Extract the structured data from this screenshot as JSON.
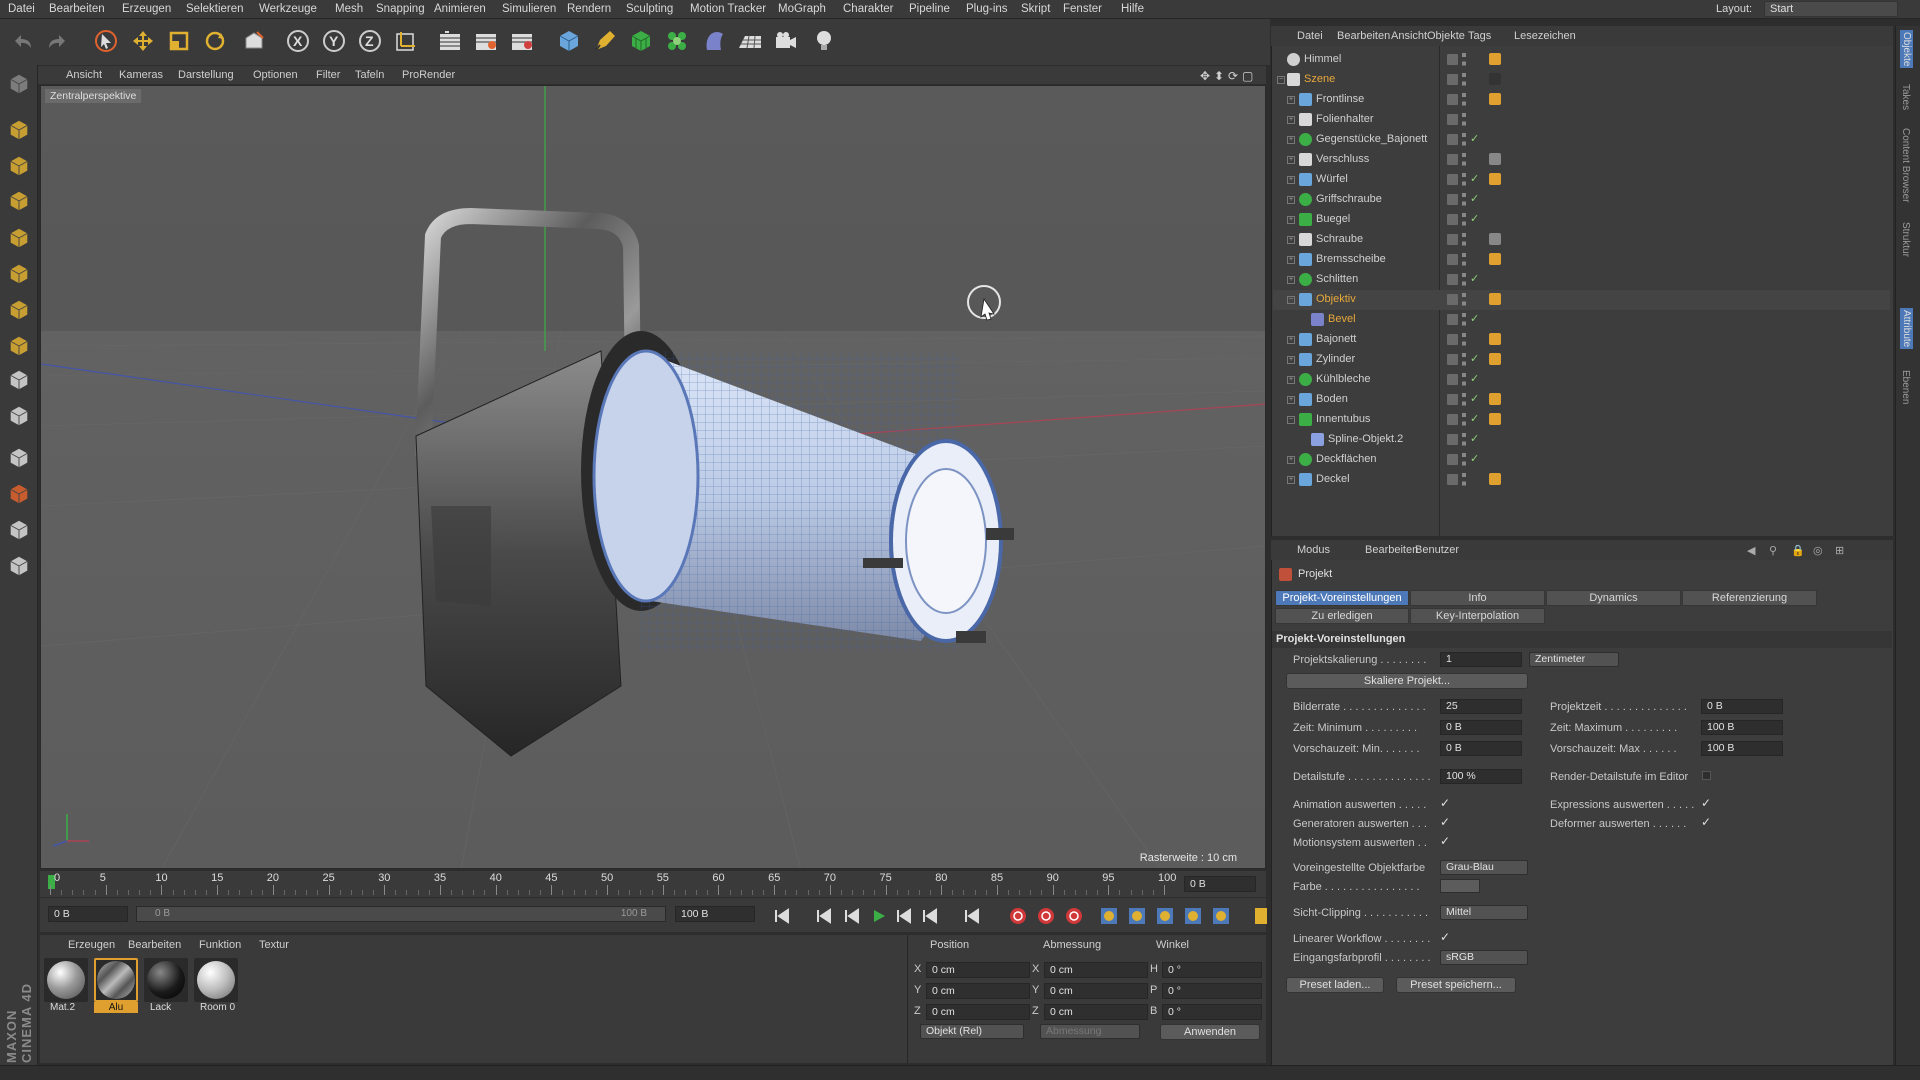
{
  "menubar": {
    "items": [
      "Datei",
      "Bearbeiten",
      "Erzeugen",
      "Selektieren",
      "Werkzeuge",
      "Mesh",
      "Snapping",
      "Animieren",
      "Simulieren",
      "Rendern",
      "Sculpting",
      "Motion Tracker",
      "MoGraph",
      "Charakter",
      "Pipeline",
      "Plug-ins",
      "Skript",
      "Fenster",
      "Hilfe"
    ],
    "layout_label": "Layout:",
    "layout_value": "Start"
  },
  "toolbar": {
    "icons": [
      "undo-icon",
      "redo-icon",
      "select-arrow-icon",
      "move-icon",
      "scale-icon",
      "rotate-icon",
      "last-tool-icon",
      "x-axis-lock-icon",
      "y-axis-lock-icon",
      "z-axis-lock-icon",
      "coordinate-system-icon",
      "render-view-icon",
      "render-picture-viewer-icon",
      "render-settings-icon",
      "cube-icon",
      "pen-icon",
      "subdivision-icon",
      "cloner-icon",
      "deformer-icon",
      "floor-icon",
      "camera-icon",
      "light-icon"
    ],
    "axis_labels": [
      "X",
      "Y",
      "Z"
    ]
  },
  "viewport": {
    "menu": [
      "Ansicht",
      "Kameras",
      "Darstellung",
      "Optionen",
      "Filter",
      "Tafeln",
      "ProRender"
    ],
    "label": "Zentralperspektive",
    "raster": "Rasterweite : 10 cm"
  },
  "timeline": {
    "ticks": [
      "0",
      "5",
      "10",
      "15",
      "20",
      "25",
      "30",
      "35",
      "40",
      "45",
      "50",
      "55",
      "60",
      "65",
      "70",
      "75",
      "80",
      "85",
      "90",
      "95",
      "100"
    ],
    "current_frame_field": "0 B",
    "start_field": "0 B",
    "range_start": "0 B",
    "range_end": "100 B",
    "end_field": "100 B"
  },
  "material_manager": {
    "tabs": [
      "Erzeugen",
      "Bearbeiten",
      "Funktion",
      "Textur"
    ],
    "materials": [
      {
        "label": "Mat.2"
      },
      {
        "label": "Alu"
      },
      {
        "label": "Lack"
      },
      {
        "label": "Room 0"
      }
    ]
  },
  "coordinate_manager": {
    "headers": [
      "Position",
      "Abmessung",
      "Winkel"
    ],
    "rows": [
      {
        "axis": "X",
        "pos": "0 cm",
        "dim_axis": "X",
        "dim": "0 cm",
        "rot_axis": "H",
        "rot": "0 °"
      },
      {
        "axis": "Y",
        "pos": "0 cm",
        "dim_axis": "Y",
        "dim": "0 cm",
        "rot_axis": "P",
        "rot": "0 °"
      },
      {
        "axis": "Z",
        "pos": "0 cm",
        "dim_axis": "Z",
        "dim": "0 cm",
        "rot_axis": "B",
        "rot": "0 °"
      }
    ],
    "mode_select": "Objekt (Rel)",
    "size_select": "Abmessung",
    "apply_button": "Anwenden"
  },
  "object_manager": {
    "menu": [
      "Datei",
      "Bearbeiten",
      "Ansicht",
      "Objekte",
      "Tags",
      "Lesezeichen"
    ],
    "objects": [
      {
        "name": "Himmel",
        "depth": 0,
        "icon": "sky-icon",
        "color": "#d0d0d0",
        "checked": false
      },
      {
        "name": "Szene",
        "depth": 0,
        "icon": "null-icon",
        "color": "#e7a83a",
        "checked": false
      },
      {
        "name": "Frontlinse",
        "depth": 1,
        "icon": "lathe-icon",
        "color": "#d0d0d0",
        "checked": false
      },
      {
        "name": "Folienhalter",
        "depth": 1,
        "icon": "null-icon",
        "color": "#d0d0d0",
        "checked": false
      },
      {
        "name": "Gegenstücke_Bajonett",
        "depth": 1,
        "icon": "symmetry-icon",
        "color": "#d0d0d0",
        "checked": true
      },
      {
        "name": "Verschluss",
        "depth": 1,
        "icon": "null-icon",
        "color": "#d0d0d0",
        "checked": false
      },
      {
        "name": "Würfel",
        "depth": 1,
        "icon": "cube-icon",
        "color": "#d0d0d0",
        "checked": true
      },
      {
        "name": "Griffschraube",
        "depth": 1,
        "icon": "symmetry-icon",
        "color": "#d0d0d0",
        "checked": true
      },
      {
        "name": "Buegel",
        "depth": 1,
        "icon": "sweep-icon",
        "color": "#d0d0d0",
        "checked": true
      },
      {
        "name": "Schraube",
        "depth": 1,
        "icon": "null-icon",
        "color": "#d0d0d0",
        "checked": false
      },
      {
        "name": "Bremsscheibe",
        "depth": 1,
        "icon": "lathe-icon",
        "color": "#d0d0d0",
        "checked": false
      },
      {
        "name": "Schlitten",
        "depth": 1,
        "icon": "symmetry-icon",
        "color": "#d0d0d0",
        "checked": true
      },
      {
        "name": "Objektiv",
        "depth": 1,
        "icon": "lathe-icon",
        "color": "#e7a83a",
        "checked": false
      },
      {
        "name": "Bevel",
        "depth": 2,
        "icon": "bevel-icon",
        "color": "#e7a83a",
        "checked": true
      },
      {
        "name": "Bajonett",
        "depth": 1,
        "icon": "lathe-icon",
        "color": "#d0d0d0",
        "checked": false
      },
      {
        "name": "Zylinder",
        "depth": 1,
        "icon": "cylinder-icon",
        "color": "#d0d0d0",
        "checked": true
      },
      {
        "name": "Kühlbleche",
        "depth": 1,
        "icon": "symmetry-icon",
        "color": "#d0d0d0",
        "checked": true
      },
      {
        "name": "Boden",
        "depth": 1,
        "icon": "cube-icon",
        "color": "#d0d0d0",
        "checked": true
      },
      {
        "name": "Innentubus",
        "depth": 1,
        "icon": "sweep-icon",
        "color": "#d0d0d0",
        "checked": true
      },
      {
        "name": "Spline-Objekt.2",
        "depth": 2,
        "icon": "spline-icon",
        "color": "#d0d0d0",
        "checked": true
      },
      {
        "name": "Deckflächen",
        "depth": 1,
        "icon": "symmetry-icon",
        "color": "#d0d0d0",
        "checked": true
      },
      {
        "name": "Deckel",
        "depth": 1,
        "icon": "lathe-icon",
        "color": "#d0d0d0",
        "checked": false
      }
    ]
  },
  "attribute_manager": {
    "menu": [
      "Modus",
      "Bearbeiten",
      "Benutzer"
    ],
    "object_title": "Projekt",
    "tabs_row1": [
      "Projekt-Voreinstellungen",
      "Info",
      "Dynamics",
      "Referenzierung"
    ],
    "tabs_row2": [
      "Zu erledigen",
      "Key-Interpolation"
    ],
    "section_title": "Projekt-Voreinstellungen",
    "projektskalierung_label": "Projektskalierung . . . . . . . .",
    "projektskalierung_value": "1",
    "projektskalierung_unit": "Zentimeter",
    "skalieren_button": "Skaliere Projekt...",
    "bilderrate_label": "Bilderrate . . . . . . . . . . . . . .",
    "bilderrate_value": "25",
    "projektzeit_label": "Projektzeit . . . . . . . . . . . . . .",
    "projektzeit_value": "0 B",
    "zeit_min_label": "Zeit: Minimum . . . . . . . . .",
    "zeit_min_value": "0 B",
    "zeit_max_label": "Zeit: Maximum . . . . . . . . .",
    "zeit_max_value": "100 B",
    "vor_min_label": "Vorschauzeit: Min. . . . . . .",
    "vor_min_value": "0 B",
    "vor_max_label": "Vorschauzeit: Max . . . . . .",
    "vor_max_value": "100 B",
    "detail_label": "Detailstufe . . . . . . . . . . . . . .",
    "detail_value": "100 %",
    "render_detail_label": "Render-Detailstufe im Editor",
    "anim_label": "Animation auswerten . . . . .",
    "expr_label": "Expressions auswerten . . . . .",
    "gen_label": "Generatoren auswerten . . .",
    "def_label": "Deformer auswerten . . . . . .",
    "motion_label": "Motionsystem auswerten . .",
    "objfarbe_label": "Voreingestellte Objektfarbe",
    "objfarbe_value": "Grau-Blau",
    "farbe_label": "Farbe . . . . . . . . . . . . . . . .",
    "clip_label": "Sicht-Clipping . . . . . . . . . . .",
    "clip_value": "Mittel",
    "linear_label": "Linearer Workflow . . . . . . . .",
    "profil_label": "Eingangsfarbprofil . . . . . . . .",
    "profil_value": "sRGB",
    "preset_load": "Preset laden...",
    "preset_save": "Preset speichern..."
  },
  "right_strip": {
    "tabs": [
      "Objekte",
      "Takes",
      "Content Browser",
      "Struktur",
      "Attribute",
      "Ebenen"
    ]
  },
  "branding": {
    "text": "MAXON CINEMA 4D"
  },
  "colors": {
    "accent": "#4d79b8",
    "active_orange": "#e7a83a",
    "panel": "#3a3a3a",
    "viewport": "#575757"
  }
}
